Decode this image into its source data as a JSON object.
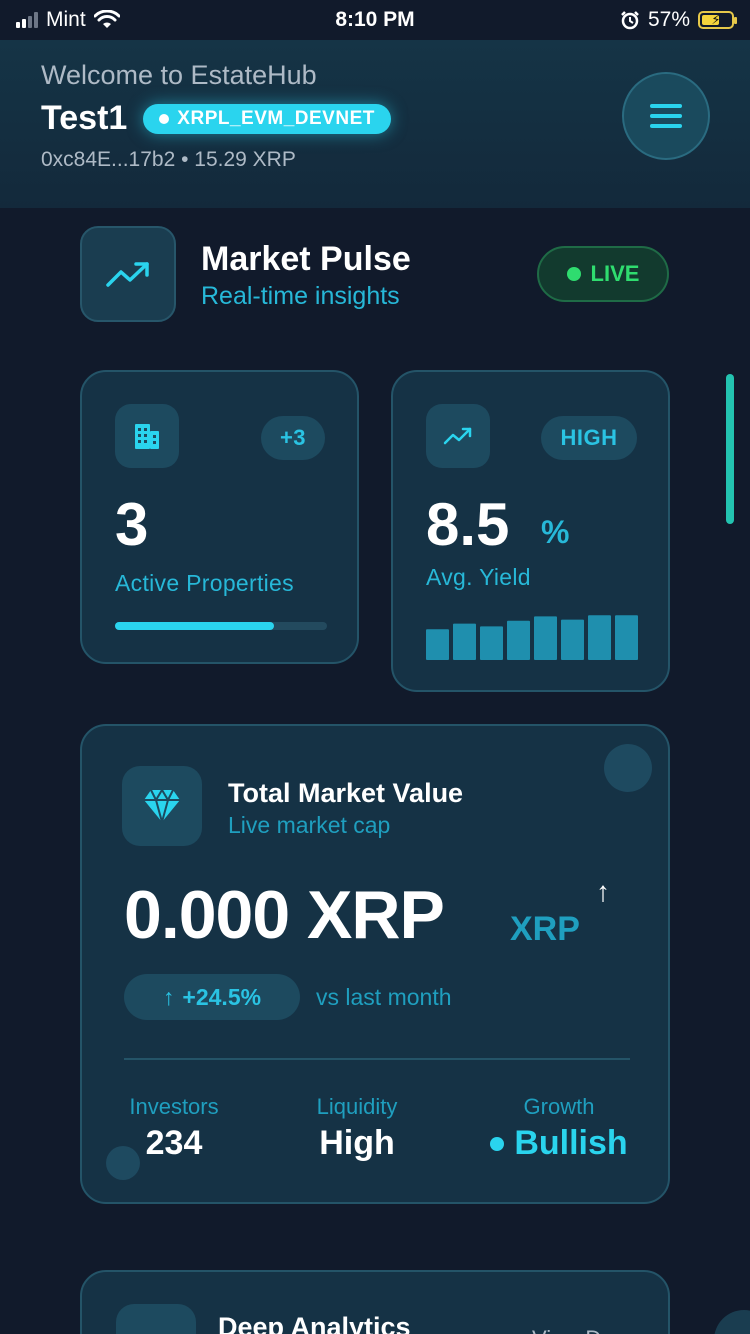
{
  "status_bar": {
    "carrier": "Mint",
    "time": "8:10 PM",
    "battery": "57%"
  },
  "header": {
    "welcome": "Welcome to EstateHub",
    "user_name": "Test1",
    "network": "XRPL_EVM_DEVNET",
    "wallet_line": "0xc84E...17b2 • 15.29 XRP"
  },
  "pulse": {
    "title": "Market Pulse",
    "subtitle": "Real-time insights",
    "live_label": "LIVE"
  },
  "cards": {
    "properties": {
      "badge": "+3",
      "value": "3",
      "label": "Active Properties",
      "progress": 0.75
    },
    "yield": {
      "badge": "HIGH",
      "value": "8.5",
      "unit": "%",
      "label": "Avg. Yield",
      "bars": [
        0.55,
        0.65,
        0.6,
        0.7,
        0.78,
        0.72,
        0.8,
        0.8
      ]
    }
  },
  "market_value": {
    "title": "Total Market Value",
    "subtitle": "Live market cap",
    "amount": "0.000 XRP",
    "unit": "XRP",
    "arrow": "↑",
    "change": "+24.5%",
    "change_arrow": "↑",
    "comparison": "vs last month",
    "stats": [
      {
        "label": "Investors",
        "value": "234"
      },
      {
        "label": "Liquidity",
        "value": "High"
      },
      {
        "label": "Growth",
        "value": "Bullish"
      }
    ]
  },
  "analytics": {
    "title": "Deep Analytics",
    "right_text": "View D"
  },
  "colors": {
    "background": "#111a2b",
    "accent": "#2ad4ee",
    "live": "#2fdc6f",
    "card": "#153245"
  },
  "icons": {
    "menu": "hamburger-icon",
    "pulse": "trending-up-icon",
    "properties": "building-icon",
    "yield": "trending-up-icon",
    "market_value": "diamond-icon"
  }
}
